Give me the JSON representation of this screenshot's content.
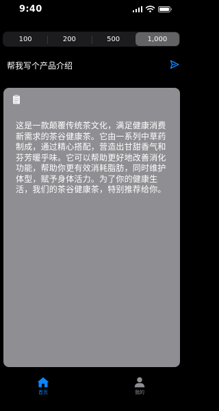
{
  "status_bar": {
    "time": "9:40"
  },
  "segmented": {
    "options": [
      "100",
      "200",
      "500",
      "1,000"
    ],
    "selected_index": 3
  },
  "prompt": {
    "text": "帮我写个产品介绍"
  },
  "card": {
    "text": "这是一款颠覆传统茶文化，满足健康消费新需求的茶谷健康茶。它由一系列中草药制成，通过精心搭配，营造出甘甜香气和芬芳暖乎味。它可以帮助更好地改善消化功能，帮助你更有效消耗脂肪，同时维护体型，赋予身体活力。为了你的健康生活，我们的茶谷健康茶，特别推荐给你。"
  },
  "tab_bar": {
    "items": [
      {
        "label": "首页",
        "icon": "home-icon",
        "active": true
      },
      {
        "label": "我的",
        "icon": "person-icon",
        "active": false
      }
    ]
  },
  "colors": {
    "accent": "#0a84ff",
    "card": "#8e8e93",
    "background": "#000000",
    "segment_active": "#636366"
  }
}
